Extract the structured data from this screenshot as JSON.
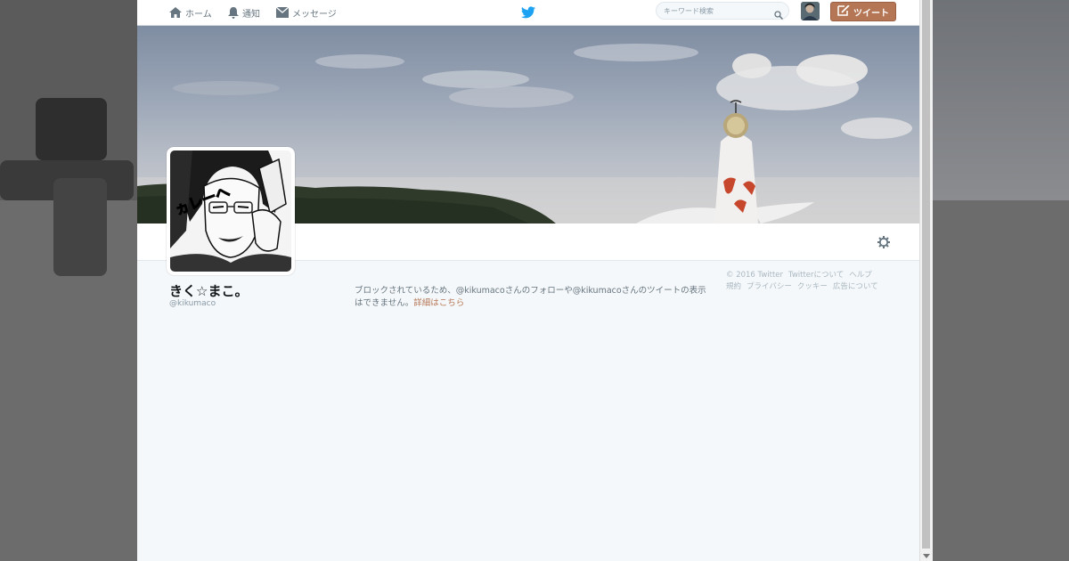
{
  "nav": {
    "home_label": "ホーム",
    "notifications_label": "通知",
    "messages_label": "メッセージ"
  },
  "search": {
    "placeholder": "キーワード検索"
  },
  "tweet_button": {
    "label": "ツイート"
  },
  "profile": {
    "name": "きく☆まこ。",
    "handle": "@kikumaco",
    "avatar_caption": "ヵレーへ"
  },
  "blocked_notice": {
    "text": "ブロックされているため、@kikumacoさんのフォローや@kikumacoさんのツイートの表示はできません。",
    "link_label": "詳細はこちら"
  },
  "footer": {
    "copyright": "© 2016 Twitter",
    "links_row1": [
      "Twitterについて",
      "ヘルプ"
    ],
    "links_row2": [
      "規約",
      "プライバシー",
      "クッキー",
      "広告について"
    ]
  },
  "colors": {
    "accent": "#b57656",
    "background": "#f5f8fa",
    "text_secondary": "#66757f",
    "twitter_blue": "#1da1f2"
  },
  "icons": {
    "home": "home-icon",
    "notifications": "bell-icon",
    "messages": "envelope-icon",
    "logo": "twitter-bird-icon",
    "search": "search-icon",
    "tweet": "compose-icon",
    "settings": "gear-icon"
  }
}
